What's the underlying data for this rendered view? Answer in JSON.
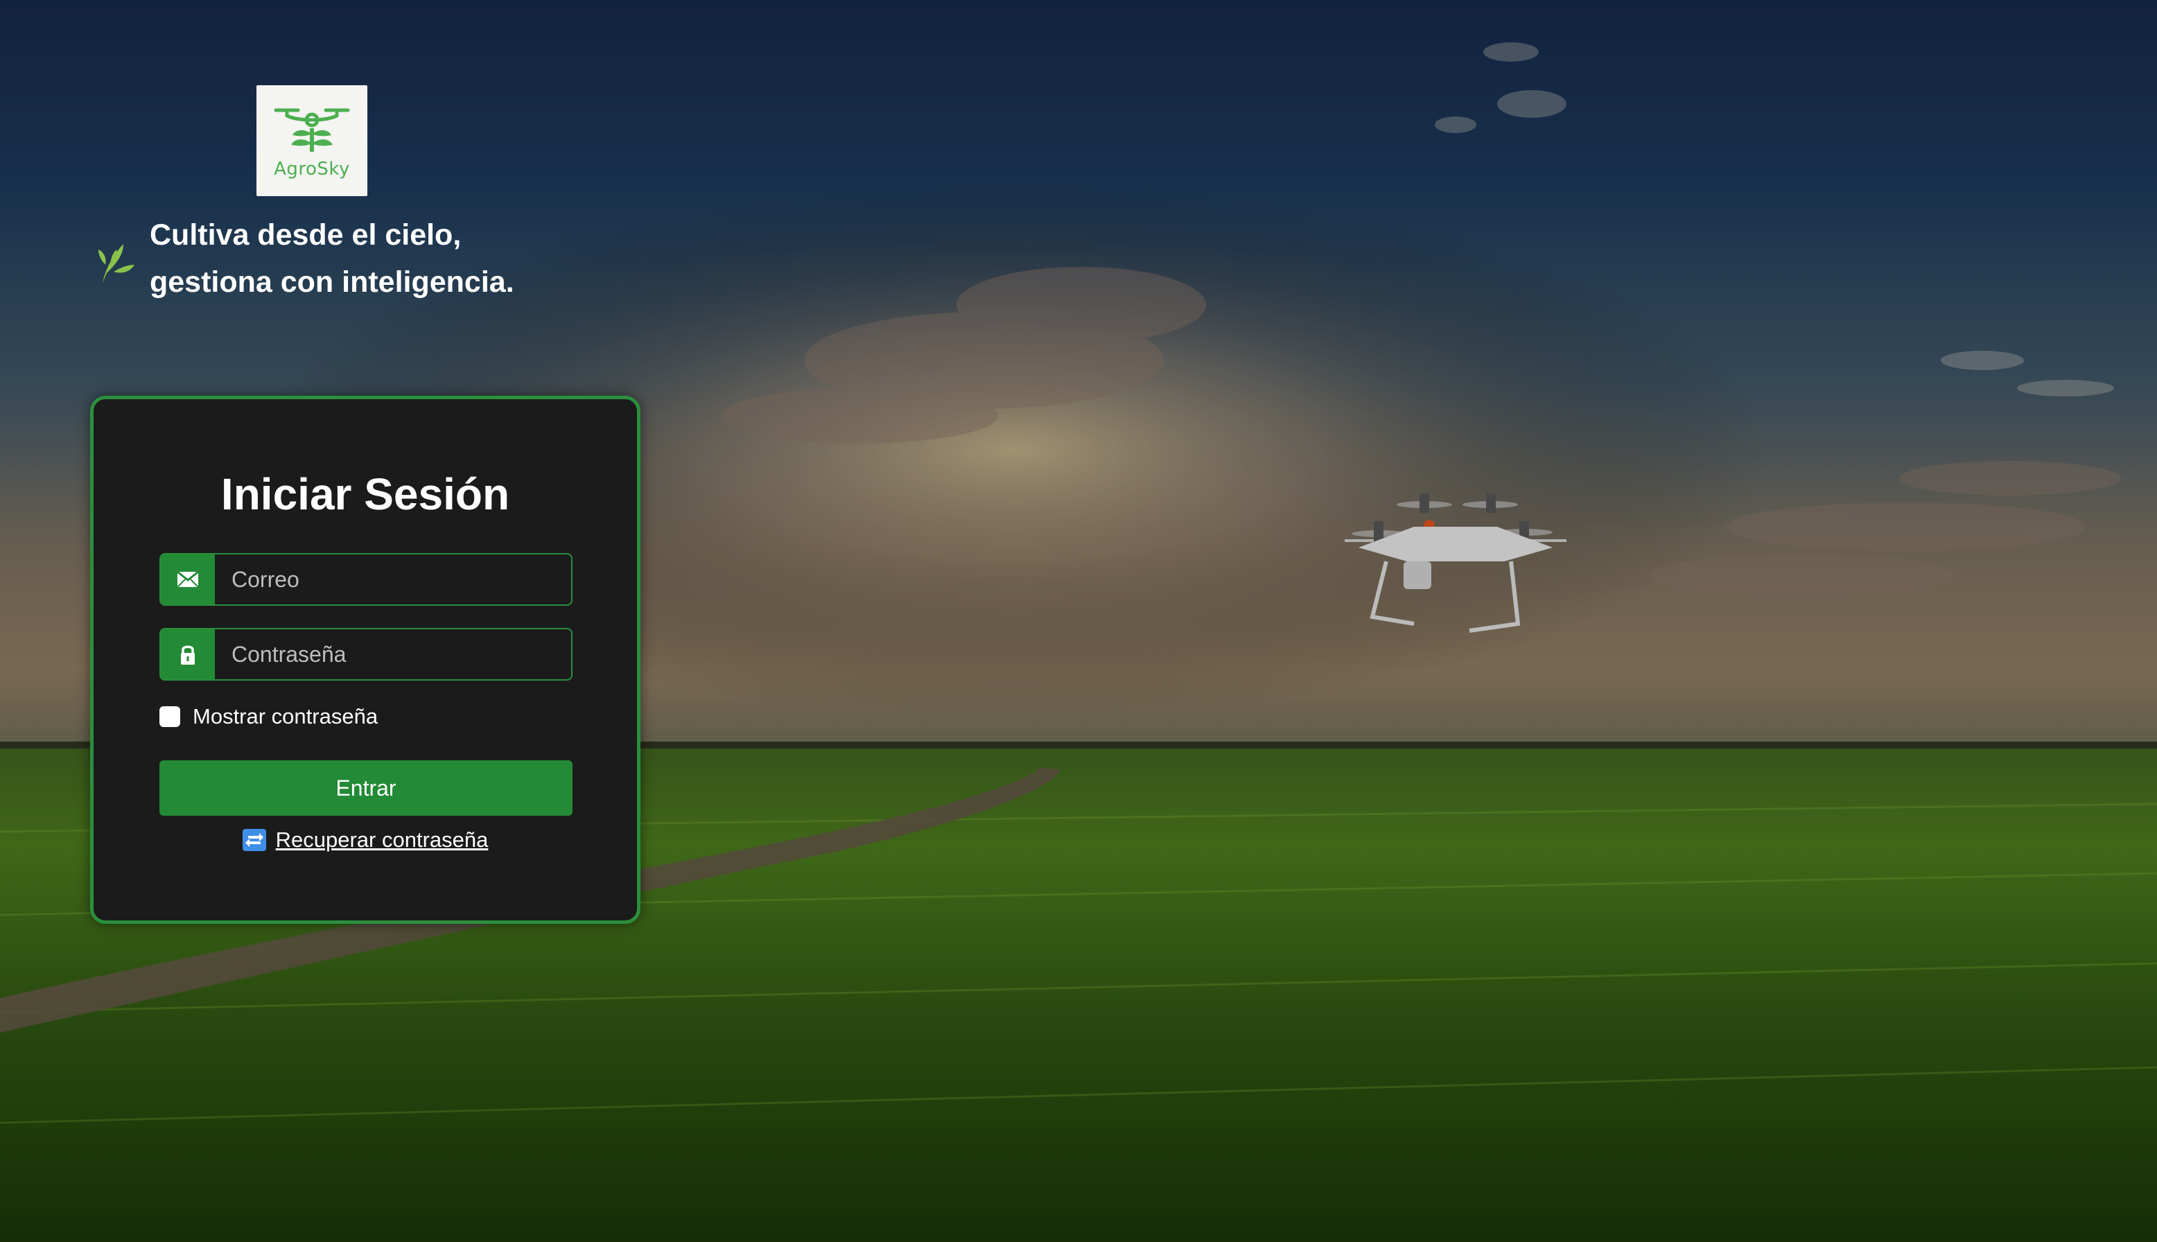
{
  "brand": {
    "name": "AgroSky",
    "accent": "#2b8f3d"
  },
  "tagline": {
    "line1": "Cultiva desde el cielo,",
    "line2": "gestiona con inteligencia.",
    "icon": "leaf-icon"
  },
  "login": {
    "title": "Iniciar Sesión",
    "email": {
      "placeholder": "Correo",
      "value": "",
      "icon": "envelope-icon"
    },
    "password": {
      "placeholder": "Contraseña",
      "value": "",
      "icon": "lock-icon"
    },
    "show_password_label": "Mostrar contraseña",
    "show_password_checked": false,
    "submit_label": "Entrar",
    "recover_label": "Recuperar contraseña",
    "recover_icon": "refresh-icon"
  }
}
